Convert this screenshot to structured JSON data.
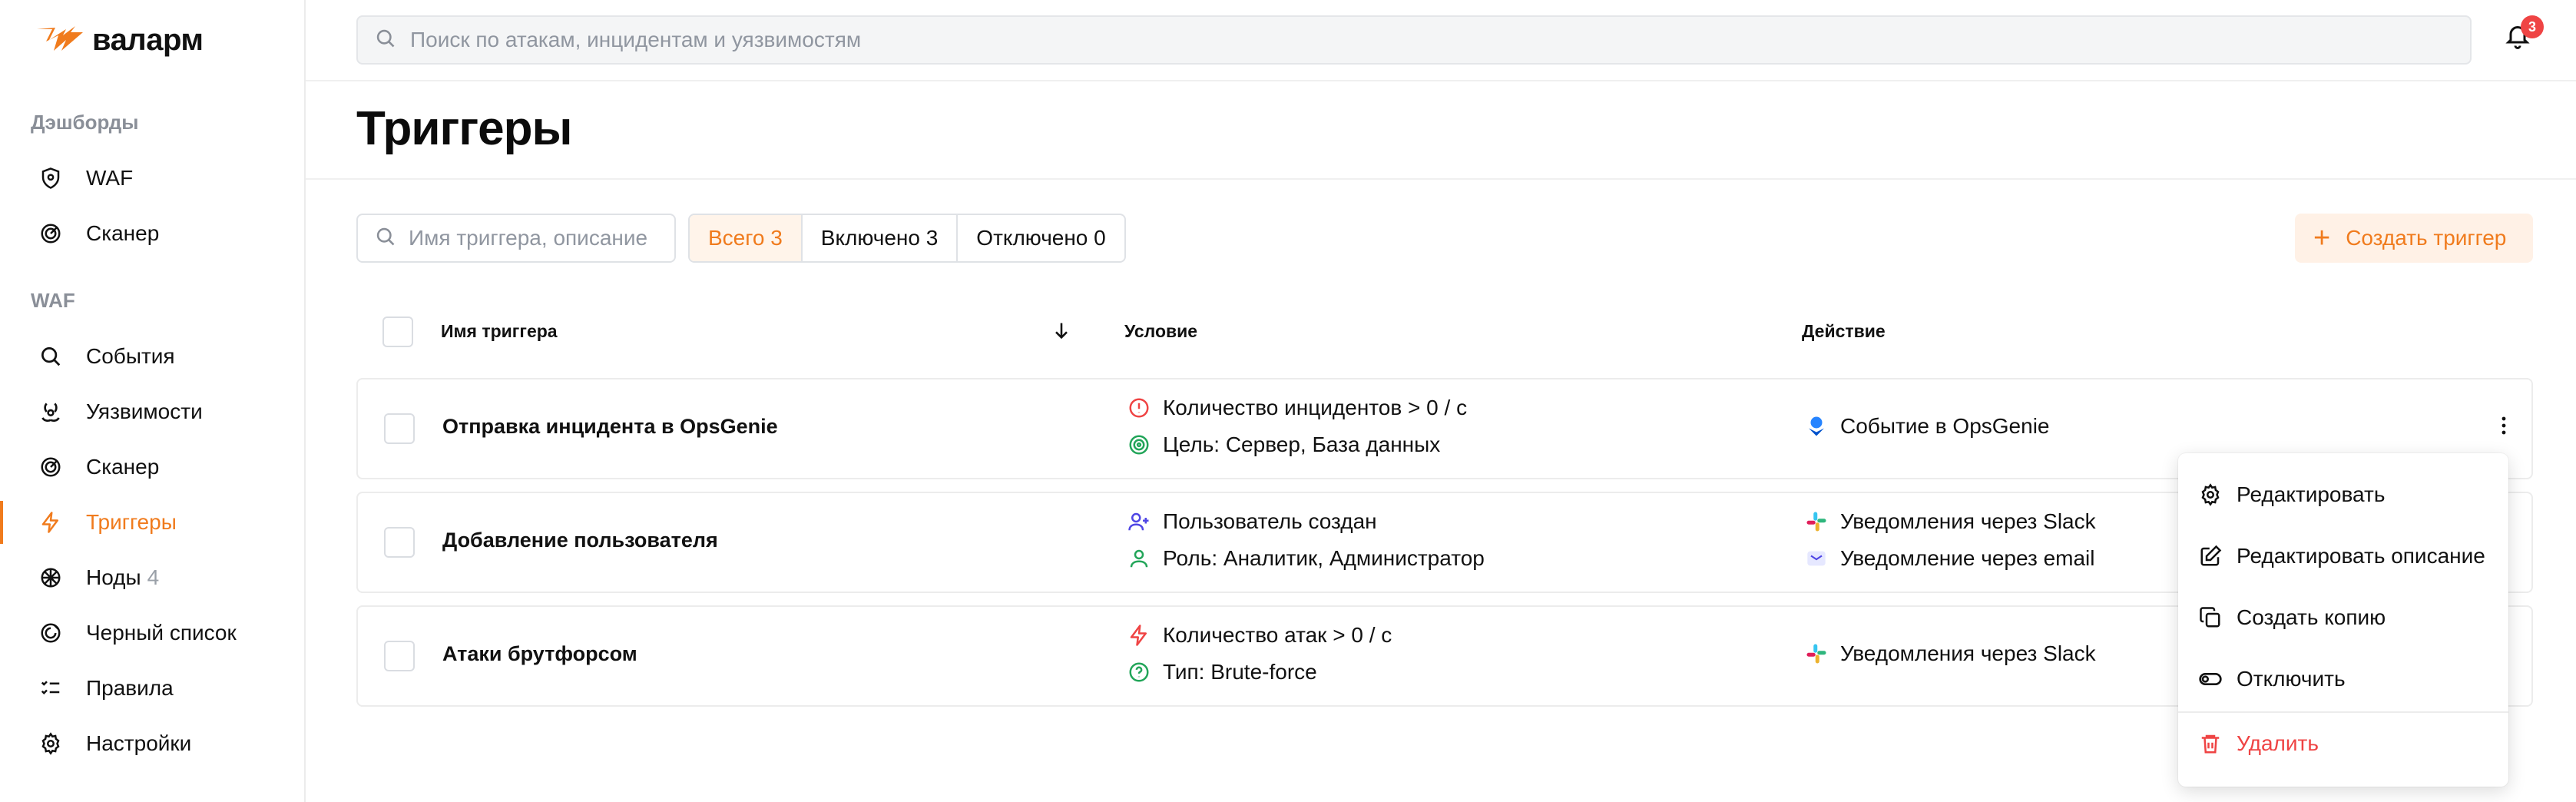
{
  "brand": {
    "name": "валарм",
    "color": "#f07b1d"
  },
  "sidebar": {
    "sections": [
      {
        "title": "Дэшборды",
        "items": [
          {
            "label": "WAF",
            "icon": "shield-icon"
          },
          {
            "label": "Сканер",
            "icon": "scanner-icon"
          }
        ]
      },
      {
        "title": "WAF",
        "items": [
          {
            "label": "События",
            "icon": "search-icon"
          },
          {
            "label": "Уязвимости",
            "icon": "biohazard-icon"
          },
          {
            "label": "Сканер",
            "icon": "scanner-icon"
          },
          {
            "label": "Триггеры",
            "icon": "lightning-icon",
            "active": true
          },
          {
            "label": "Ноды",
            "icon": "nodes-icon",
            "count": "4"
          },
          {
            "label": "Черный список",
            "icon": "blacklist-icon"
          },
          {
            "label": "Правила",
            "icon": "rules-icon"
          },
          {
            "label": "Настройки",
            "icon": "gear-icon"
          }
        ]
      }
    ]
  },
  "topbar": {
    "search_placeholder": "Поиск по атакам, инцидентам и уязвимостям",
    "notifications_count": "3"
  },
  "page": {
    "title": "Триггеры"
  },
  "filters": {
    "search_placeholder": "Имя триггера, описание",
    "segments": [
      {
        "label": "Всего 3",
        "active": true
      },
      {
        "label": "Включено 3"
      },
      {
        "label": "Отключено 0"
      }
    ],
    "create_label": "Создать триггер"
  },
  "table": {
    "columns": {
      "name": "Имя триггера",
      "condition": "Условие",
      "action": "Действие"
    },
    "rows": [
      {
        "name": "Отправка инцидента в OpsGenie",
        "conditions": [
          {
            "icon": "alert-circle-icon",
            "text": "Количество инцидентов > 0 / с"
          },
          {
            "icon": "target-icon",
            "text": "Цель: Сервер, База данных"
          }
        ],
        "actions": [
          {
            "icon": "opsgenie-icon",
            "text": "Событие в OpsGenie"
          }
        ]
      },
      {
        "name": "Добавление пользователя",
        "conditions": [
          {
            "icon": "user-plus-icon",
            "text": "Пользователь создан"
          },
          {
            "icon": "user-icon",
            "text": "Роль: Аналитик, Администратор"
          }
        ],
        "actions": [
          {
            "icon": "slack-icon",
            "text": "Уведомления через Slack"
          },
          {
            "icon": "mail-icon",
            "text": "Уведомление через email"
          }
        ]
      },
      {
        "name": "Атаки брутфорсом",
        "conditions": [
          {
            "icon": "lightning-icon",
            "text": "Количество атак > 0 / с"
          },
          {
            "icon": "question-circle-icon",
            "text": "Тип: Brute-force"
          }
        ],
        "actions": [
          {
            "icon": "slack-icon",
            "text": "Уведомления через Slack"
          }
        ]
      }
    ]
  },
  "context_menu": {
    "items": [
      {
        "label": "Редактировать",
        "icon": "gear-icon"
      },
      {
        "label": "Редактировать описание",
        "icon": "edit-icon"
      },
      {
        "label": "Создать копию",
        "icon": "copy-icon"
      },
      {
        "label": "Отключить",
        "icon": "toggle-icon"
      },
      {
        "label": "Удалить",
        "icon": "trash-icon",
        "danger": true
      }
    ]
  }
}
